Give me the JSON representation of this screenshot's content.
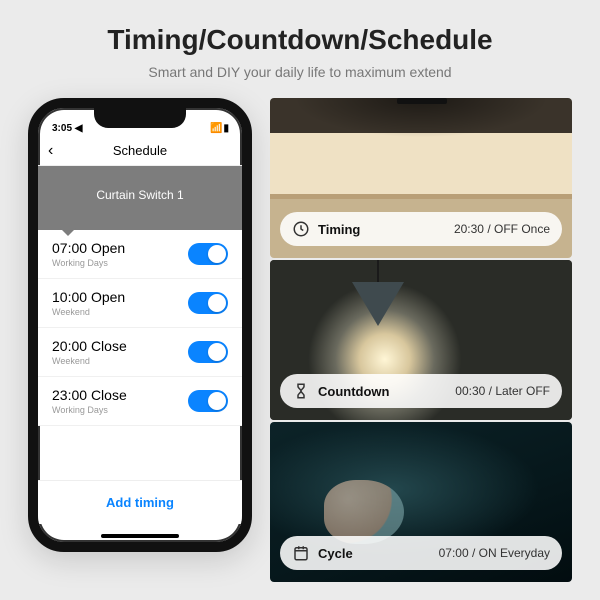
{
  "headline": "Timing/Countdown/Schedule",
  "subhead": "Smart and DIY your daily life to maximum extend",
  "phone": {
    "status": {
      "time": "3:05 ◀",
      "right": "📶 ▮"
    },
    "nav": {
      "title": "Schedule",
      "back": "‹"
    },
    "device_name": "Curtain Switch 1",
    "add_label": "Add timing",
    "schedule": [
      {
        "time": "07:00",
        "action": "Open",
        "repeat": "Working Days",
        "on": true
      },
      {
        "time": "10:00",
        "action": "Open",
        "repeat": "Weekend",
        "on": true
      },
      {
        "time": "20:00",
        "action": "Close",
        "repeat": "Weekend",
        "on": true
      },
      {
        "time": "23:00",
        "action": "Close",
        "repeat": "Working Days",
        "on": true
      }
    ]
  },
  "features": [
    {
      "icon": "clock-icon",
      "label": "Timing",
      "value": "20:30 / OFF Once"
    },
    {
      "icon": "hourglass-icon",
      "label": "Countdown",
      "value": "00:30 / Later OFF"
    },
    {
      "icon": "calendar-icon",
      "label": "Cycle",
      "value": "07:00 / ON Everyday"
    }
  ],
  "colors": {
    "accent": "#0a84ff"
  }
}
